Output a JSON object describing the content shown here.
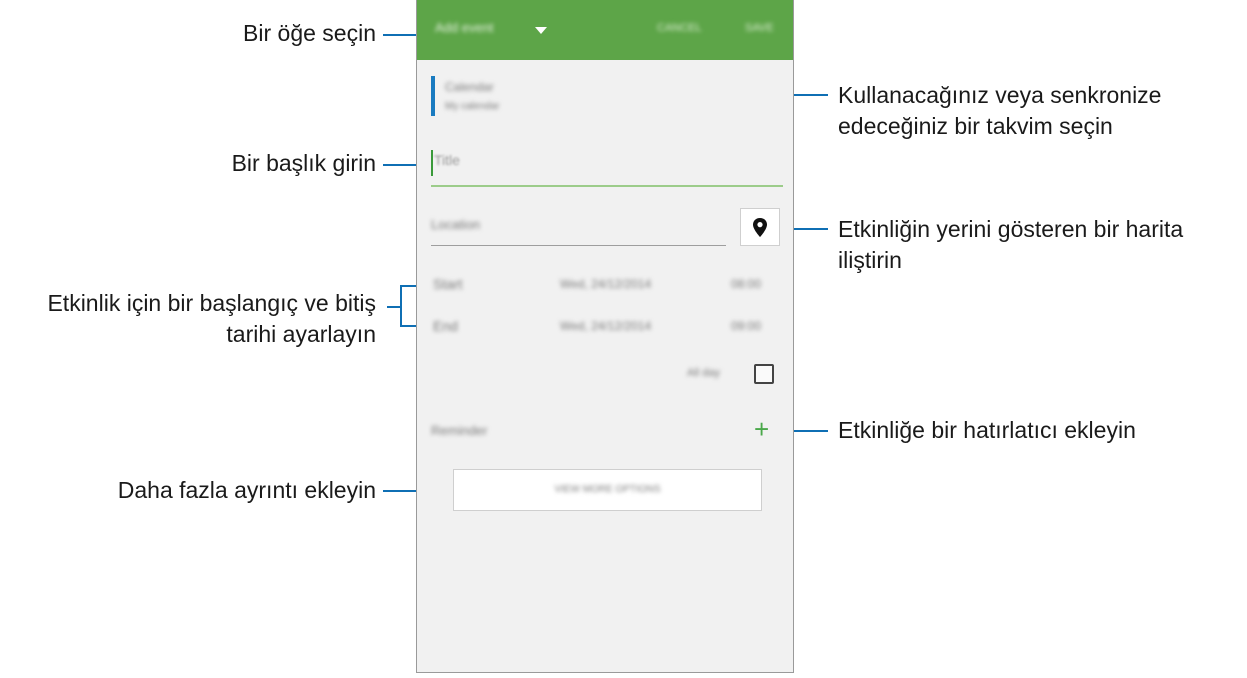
{
  "callouts": {
    "select_item": "Bir öğe seçin",
    "enter_title": "Bir başlık girin",
    "start_end_1": "Etkinlik için bir başlangıç ve bitiş",
    "start_end_2": "tarihi ayarlayın",
    "more_details": "Daha fazla ayrıntı ekleyin",
    "calendar_1": "Kullanacağınız veya senkronize",
    "calendar_2": "edeceğiniz bir takvim seçin",
    "map_1": "Etkinliğin yerini gösteren bir harita",
    "map_2": "iliştirin",
    "reminder": "Etkinliğe bir hatırlatıcı ekleyin"
  },
  "app": {
    "header": {
      "title": "Add event",
      "cancel": "CANCEL",
      "save": "SAVE"
    },
    "calendar": {
      "name": "Calendar",
      "account": "My calendar"
    },
    "title_placeholder": "Title",
    "location_placeholder": "Location",
    "start": {
      "label": "Start",
      "date": "Wed, 24/12/2014",
      "time": "08:00"
    },
    "end": {
      "label": "End",
      "date": "Wed, 24/12/2014",
      "time": "09:00"
    },
    "all_day": "All day",
    "reminder": "Reminder",
    "more_options": "VIEW MORE OPTIONS"
  },
  "colors": {
    "header": "#5da548",
    "accent": "#1a7bc0",
    "callout_line": "#0f6fb4"
  }
}
